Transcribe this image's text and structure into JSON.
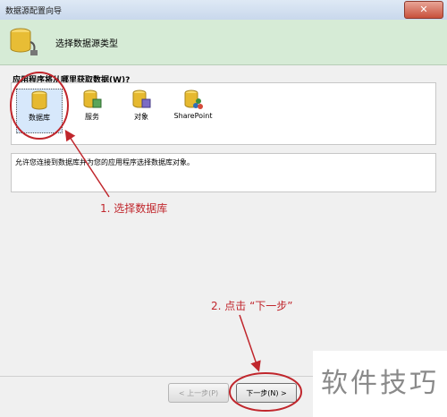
{
  "window": {
    "title": "数据源配置向导",
    "close_label": "✕"
  },
  "header": {
    "title": "选择数据源类型"
  },
  "question": "应用程序将从哪里获取数据(W)?",
  "options": [
    {
      "label": "数据库",
      "icon": "database-icon",
      "selected": true
    },
    {
      "label": "服务",
      "icon": "service-icon",
      "selected": false
    },
    {
      "label": "对象",
      "icon": "object-icon",
      "selected": false
    },
    {
      "label": "SharePoint",
      "icon": "sharepoint-icon",
      "selected": false
    }
  ],
  "description": "允许您连接到数据库并为您的应用程序选择数据库对象。",
  "annotations": {
    "step1": "1. 选择数据库",
    "step2": "2. 点击 “下一步”"
  },
  "buttons": {
    "prev": "< 上一步(P)",
    "next": "下一步(N) >"
  },
  "watermark": "软件技巧",
  "colors": {
    "annotation": "#c0262c",
    "header_bg": "#d6ebd6"
  }
}
